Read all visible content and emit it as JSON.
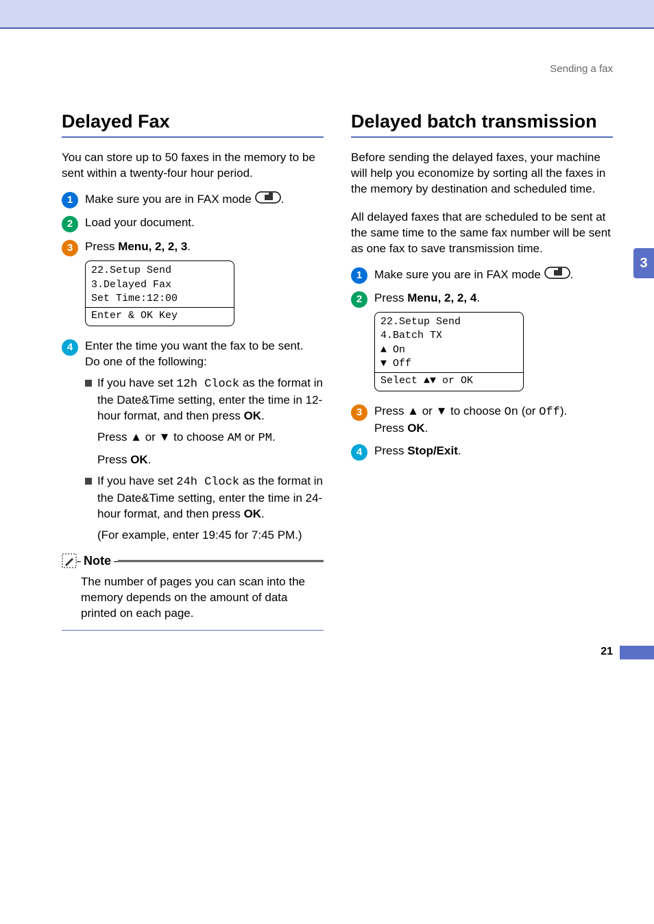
{
  "breadcrumb": "Sending a fax",
  "side_tab": "3",
  "page_number": "21",
  "left": {
    "title": "Delayed Fax",
    "intro": "You can store up to 50 faxes in the memory to be sent within a twenty-four hour period.",
    "step1": "Make sure you are in FAX mode ",
    "step2": "Load your document.",
    "step3_pre": "Press ",
    "step3_menu": "Menu",
    "step3_seq": ", 2, 2, 3",
    "lcd": {
      "l1": "22.Setup Send",
      "l2": " 3.Delayed Fax",
      "l3": "",
      "l4": " Set Time:12:00",
      "l5": "Enter & OK Key"
    },
    "step4_a": "Enter the time you want the fax to be sent.",
    "step4_b": "Do one of the following:",
    "b1_pre": "If you have set ",
    "b1_code": "12h Clock",
    "b1_mid": " as the format in the Date&Time setting, enter the time in 12-hour format, and then press ",
    "b1_ok": "OK",
    "b1_p2_pre": "Press ▲ or ▼ to choose ",
    "b1_p2_am": "AM",
    "b1_p2_or": " or ",
    "b1_p2_pm": "PM",
    "b1_p3_pre": "Press ",
    "b1_p3_ok": "OK",
    "b2_pre": "If you have set ",
    "b2_code": "24h Clock",
    "b2_mid": " as the format in the Date&Time setting, enter the time in 24-hour format, and then press ",
    "b2_ok": "OK",
    "b2_p2": "(For example, enter 19:45 for 7:45 PM.)",
    "note_label": "Note",
    "note_body": "The number of pages you can scan into the memory depends on the amount of data printed on each page."
  },
  "right": {
    "title": "Delayed batch transmission",
    "intro1": "Before sending the delayed faxes, your machine will help you economize by sorting all the faxes in the memory by destination and scheduled time.",
    "intro2": "All delayed faxes that are scheduled to be sent at the same time to the same fax number will be sent as one fax to save transmission time.",
    "step1": "Make sure you are in FAX mode ",
    "step2_pre": "Press ",
    "step2_menu": "Menu",
    "step2_seq": ", 2, 2, 4",
    "lcd": {
      "l1": "22.Setup Send",
      "l2": " 4.Batch TX",
      "l3": "▲   On",
      "l4": "▼   Off",
      "l5": "Select ▲▼ or OK"
    },
    "step3_pre": "Press ▲ or ▼ to choose ",
    "step3_on": "On",
    "step3_mid": " (or ",
    "step3_off": "Off",
    "step3_post": ").",
    "step3_b_pre": "Press ",
    "step3_b_ok": "OK",
    "step4_pre": "Press ",
    "step4_btn": "Stop/Exit"
  }
}
